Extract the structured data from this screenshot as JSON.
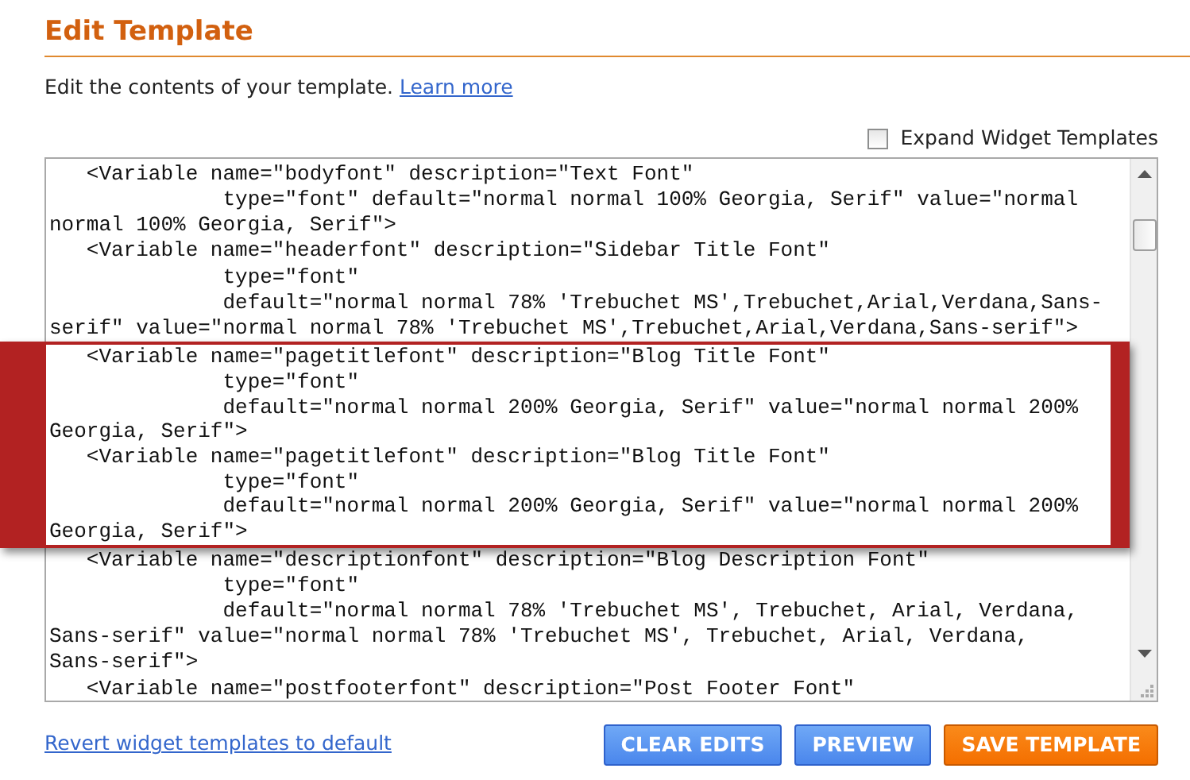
{
  "header": {
    "title": "Edit Template"
  },
  "intro": {
    "text": "Edit the contents of your template.",
    "link": "Learn more"
  },
  "expand_widget_templates": {
    "label": "Expand Widget Templates",
    "checked": false
  },
  "editor": {
    "lines_above": [
      "   <Variable name=\"bodyfont\" description=\"Text Font\"",
      "              type=\"font\" default=\"normal normal 100% Georgia, Serif\" value=\"normal",
      "normal 100% Georgia, Serif\">",
      "   <Variable name=\"headerfont\" description=\"Sidebar Title Font\"",
      "              type=\"font\"",
      "              default=\"normal normal 78% 'Trebuchet MS',Trebuchet,Arial,Verdana,Sans-",
      "serif\" value=\"normal normal 78% 'Trebuchet MS',Trebuchet,Arial,Verdana,Sans-serif\">"
    ],
    "lines_below": [
      "   <Variable name=\"descriptionfont\" description=\"Blog Description Font\"",
      "              type=\"font\"",
      "              default=\"normal normal 78% 'Trebuchet MS', Trebuchet, Arial, Verdana,",
      "Sans-serif\" value=\"normal normal 78% 'Trebuchet MS', Trebuchet, Arial, Verdana,",
      "Sans-serif\">",
      "   <Variable name=\"postfooterfont\" description=\"Post Footer Font\""
    ]
  },
  "highlight": {
    "lines": [
      "   <Variable name=\"pagetitlefont\" description=\"Blog Title Font\"",
      "              type=\"font\"",
      "              default=\"normal normal 200% Georgia, Serif\" value=\"normal normal 200%",
      "Georgia, Serif\">",
      "   <Variable name=\"pagetitlefont\" description=\"Blog Title Font\"",
      "              type=\"font\"",
      "              default=\"normal normal 200% Georgia, Serif\" value=\"normal normal 200%",
      "Georgia, Serif\">"
    ]
  },
  "footer": {
    "link": "Revert widget templates to default",
    "buttons": [
      {
        "label": "CLEAR EDITS",
        "kind": "blue"
      },
      {
        "label": "PREVIEW",
        "kind": "blue"
      },
      {
        "label": "SAVE TEMPLATE",
        "kind": "orange"
      }
    ]
  }
}
